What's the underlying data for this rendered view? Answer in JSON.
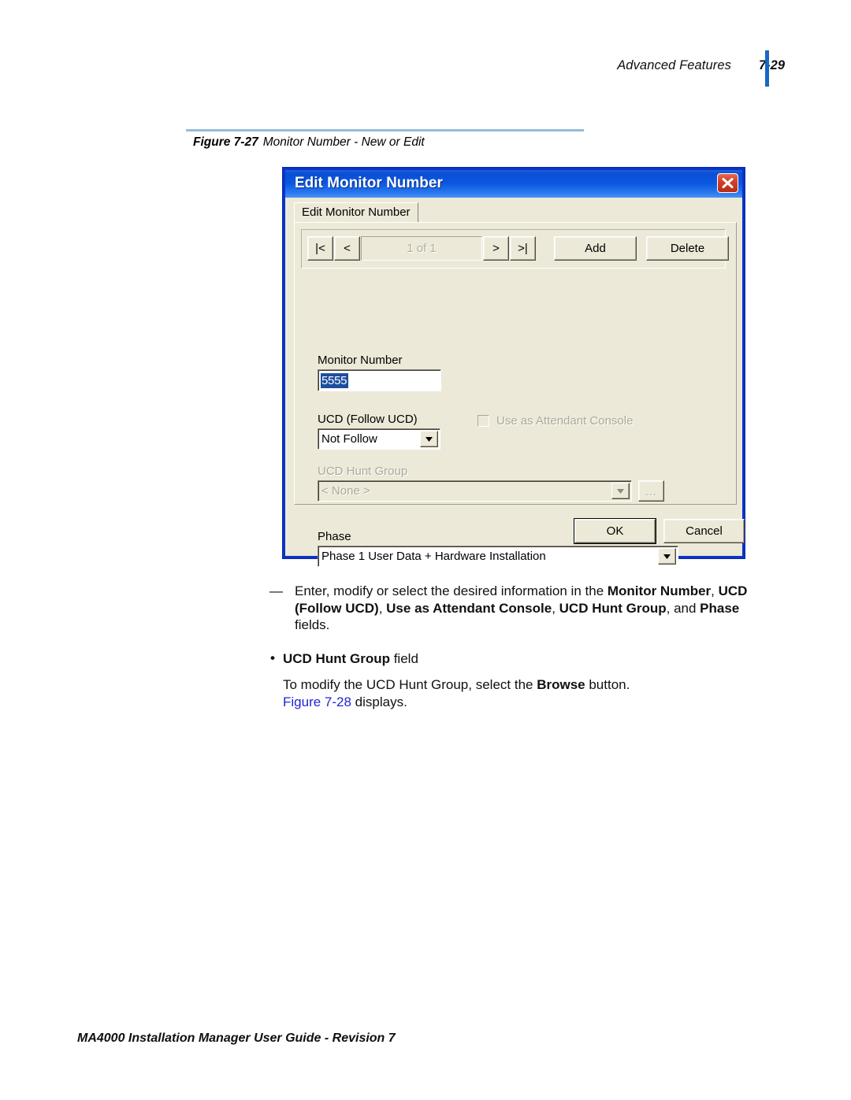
{
  "header": {
    "title": "Advanced Features",
    "page_number": "7-29",
    "accent_color": "#1668c2"
  },
  "figure": {
    "label": "Figure 7-27",
    "caption": "Monitor Number - New or Edit",
    "rule_color": "#93bdda"
  },
  "dialog": {
    "title": "Edit Monitor Number",
    "close_icon": "close-x-icon",
    "titlebar_color": "#0b56e1",
    "face_color": "#ece9d8",
    "tab": {
      "label": "Edit Monitor Number"
    },
    "nav": {
      "first_label": "|<",
      "prev_label": "<",
      "position_label": "1 of 1",
      "next_label": ">",
      "last_label": ">|",
      "add_label": "Add",
      "delete_label": "Delete"
    },
    "fields": {
      "monitor_number": {
        "label": "Monitor Number",
        "value": "5555",
        "selection_color": "#1d4f9e"
      },
      "ucd_follow_ucd": {
        "label": "UCD (Follow UCD)",
        "value": "Not Follow"
      },
      "use_as_attendant_console": {
        "label": "Use as Attendant Console",
        "checked": false,
        "disabled": true
      },
      "ucd_hunt_group": {
        "label": "UCD Hunt Group",
        "value": "< None >",
        "disabled": true,
        "browse_label": "..."
      },
      "phase": {
        "label": "Phase",
        "value": "Phase 1 User Data + Hardware Installation"
      }
    },
    "buttons": {
      "ok_label": "OK",
      "cancel_label": "Cancel"
    }
  },
  "body": {
    "dash_marker": "—",
    "dash_part1": "Enter, modify or select the desired information in the ",
    "dash_bold1": "Monitor Number",
    "dash_sep1": ", ",
    "dash_bold2": "UCD (Follow UCD)",
    "dash_sep2": ", ",
    "dash_bold3": "Use as Attendant Console",
    "dash_sep3": ", ",
    "dash_bold4": "UCD Hunt Group",
    "dash_sep4": ", and ",
    "dash_bold5": "Phase",
    "dash_tail": " fields.",
    "bullet_marker": "•",
    "bullet_bold": "UCD Hunt Group",
    "bullet_normal": " field",
    "bullet_text1": "To modify the UCD Hunt Group, select the ",
    "bullet_bold2": "Browse",
    "bullet_text2": " button.",
    "bullet_link": "Figure 7-28",
    "bullet_text3": " displays.",
    "link_color": "#2323d6"
  },
  "footer": {
    "text": "MA4000 Installation Manager User Guide - Revision 7"
  }
}
